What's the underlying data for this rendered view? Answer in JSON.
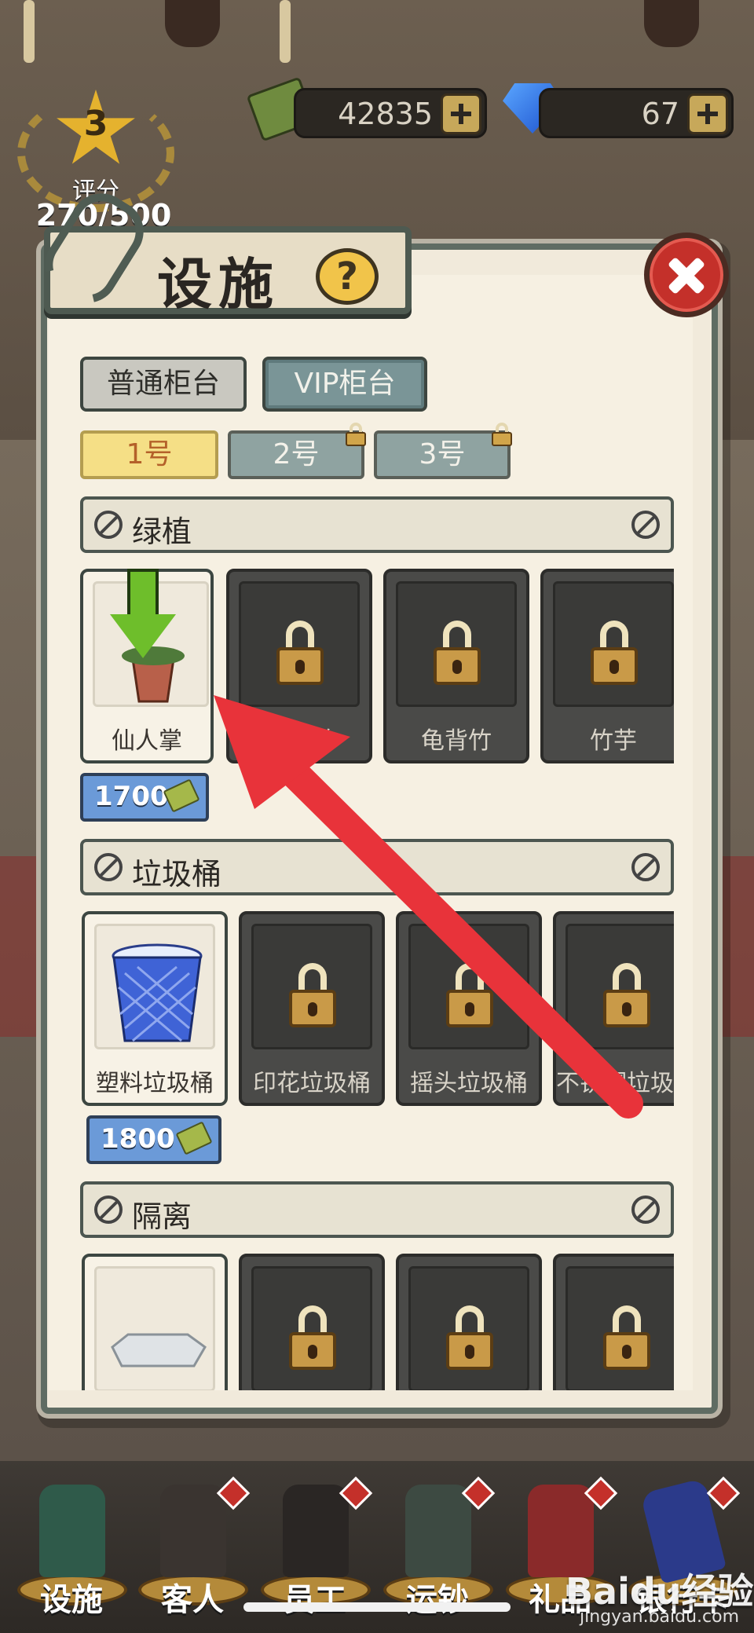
{
  "hud": {
    "rating_level": "3",
    "rating_label": "评分",
    "rating_score": "270/500",
    "cash": "42835",
    "gems": "67"
  },
  "dialog": {
    "title": "设施",
    "help_symbol": "?",
    "counter_tabs": [
      "普通柜台",
      "VIP柜台"
    ],
    "number_tabs": [
      "1号",
      "2号",
      "3号"
    ],
    "sections": [
      {
        "label": "绿植",
        "items": [
          {
            "name": "仙人掌",
            "locked": false
          },
          {
            "name": "虎尾兰",
            "locked": true
          },
          {
            "name": "龟背竹",
            "locked": true
          },
          {
            "name": "竹芋",
            "locked": true
          }
        ],
        "price": "1700"
      },
      {
        "label": "垃圾桶",
        "items": [
          {
            "name": "塑料垃圾桶",
            "locked": false
          },
          {
            "name": "印花垃圾桶",
            "locked": true
          },
          {
            "name": "摇头垃圾桶",
            "locked": true
          },
          {
            "name": "不锈钢垃圾桶",
            "locked": true
          }
        ],
        "price": "1800"
      },
      {
        "label": "隔离",
        "items": [
          {
            "name": "",
            "locked": false
          },
          {
            "name": "",
            "locked": true
          },
          {
            "name": "",
            "locked": true
          },
          {
            "name": "",
            "locked": true
          }
        ]
      }
    ]
  },
  "nav": [
    "设施",
    "客人",
    "员工",
    "运钞",
    "礼品",
    "银行卡"
  ],
  "watermark": {
    "brand": "Baidu经验",
    "url": "jingyan.baidu.com"
  },
  "colors": {
    "accent_red": "#c4302a",
    "active_tab": "#f5df86",
    "vip_tab": "#7a9597",
    "price_blue": "#6b9ad8"
  }
}
